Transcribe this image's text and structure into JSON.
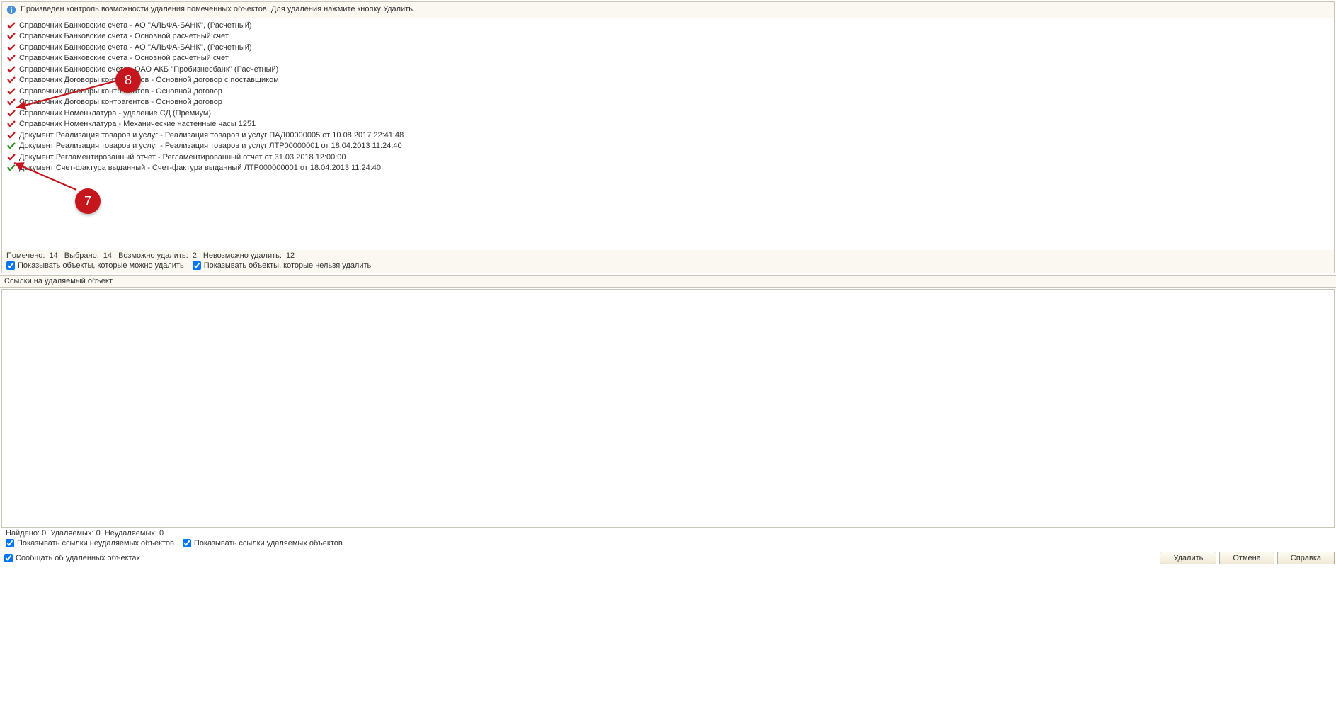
{
  "info_message": "Произведен контроль возможности удаления помеченных объектов. Для удаления нажмите кнопку Удалить.",
  "items": [
    {
      "ok": false,
      "text": "Справочник Банковские счета - АО ''АЛЬФА-БАНК'', (Расчетный)"
    },
    {
      "ok": false,
      "text": "Справочник Банковские счета - Основной расчетный счет"
    },
    {
      "ok": false,
      "text": "Справочник Банковские счета - АО ''АЛЬФА-БАНК'', (Расчетный)"
    },
    {
      "ok": false,
      "text": "Справочник Банковские счета - Основной расчетный счет"
    },
    {
      "ok": false,
      "text": "Справочник Банковские счета - ОАО АКБ ''Пробизнесбанк'' (Расчетный)"
    },
    {
      "ok": false,
      "text": "Справочник Договоры контрагентов - Основной договор с поставщиком"
    },
    {
      "ok": false,
      "text": "Справочник Договоры контрагентов - Основной договор"
    },
    {
      "ok": false,
      "text": "Справочник Договоры контрагентов - Основной договор"
    },
    {
      "ok": false,
      "text": "Справочник Номенклатура - удаление СД (Премиум)"
    },
    {
      "ok": false,
      "text": "Справочник Номенклатура - Механические настенные часы 1251"
    },
    {
      "ok": false,
      "text": "Документ Реализация товаров и услуг - Реализация товаров и услуг ПАД00000005 от 10.08.2017 22:41:48"
    },
    {
      "ok": true,
      "text": "Документ Реализация товаров и услуг - Реализация товаров и услуг ЛТР00000001 от 18.04.2013 11:24:40"
    },
    {
      "ok": false,
      "text": "Документ Регламентированный отчет - Регламентированный отчет от 31.03.2018 12:00:00"
    },
    {
      "ok": true,
      "text": "Документ Счет-фактура выданный - Счет-фактура выданный ЛТР000000001 от 18.04.2013 11:24:40"
    }
  ],
  "summary": {
    "marked_label": "Помечено:",
    "marked_value": "14",
    "selected_label": "Выбрано:",
    "selected_value": "14",
    "can_delete_label": "Возможно удалить:",
    "can_delete_value": "2",
    "cannot_delete_label": "Невозможно удалить:",
    "cannot_delete_value": "12"
  },
  "chk_show_deletable": "Показывать объекты, которые можно удалить",
  "chk_show_nondeletable": "Показывать объекты, которые нельзя удалить",
  "refs_title": "Ссылки на удаляемый объект",
  "bottom_summary": {
    "found_label": "Найдено:",
    "found_value": "0",
    "deletable_label": "Удаляемых:",
    "deletable_value": "0",
    "nondeletable_label": "Неудаляемых:",
    "nondeletable_value": "0"
  },
  "chk_show_refs_nondel": "Показывать ссылки неудаляемых объектов",
  "chk_show_refs_del": "Показывать ссылки удаляемых объектов",
  "chk_report": "Сообщать об удаленных объектах",
  "btn_delete": "Удалить",
  "btn_cancel": "Отмена",
  "btn_help": "Справка",
  "annotations": {
    "badge7": "7",
    "badge8": "8"
  }
}
